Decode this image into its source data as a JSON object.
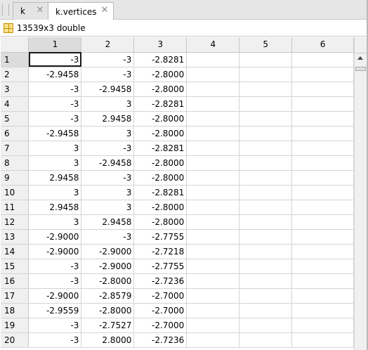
{
  "tabs": [
    {
      "label": "k",
      "active": false,
      "close_icon": "close-icon"
    },
    {
      "label": "k.vertices",
      "active": true,
      "close_icon": "close-icon"
    }
  ],
  "info": {
    "icon": "grid-icon",
    "text": "13539x3 double"
  },
  "table": {
    "columns": [
      "1",
      "2",
      "3",
      "4",
      "5",
      "6"
    ],
    "rows": [
      {
        "index": "1",
        "cells": [
          "-3",
          "-3",
          "-2.8281",
          "",
          "",
          ""
        ]
      },
      {
        "index": "2",
        "cells": [
          "-2.9458",
          "-3",
          "-2.8000",
          "",
          "",
          ""
        ]
      },
      {
        "index": "3",
        "cells": [
          "-3",
          "-2.9458",
          "-2.8000",
          "",
          "",
          ""
        ]
      },
      {
        "index": "4",
        "cells": [
          "-3",
          "3",
          "-2.8281",
          "",
          "",
          ""
        ]
      },
      {
        "index": "5",
        "cells": [
          "-3",
          "2.9458",
          "-2.8000",
          "",
          "",
          ""
        ]
      },
      {
        "index": "6",
        "cells": [
          "-2.9458",
          "3",
          "-2.8000",
          "",
          "",
          ""
        ]
      },
      {
        "index": "7",
        "cells": [
          "3",
          "-3",
          "-2.8281",
          "",
          "",
          ""
        ]
      },
      {
        "index": "8",
        "cells": [
          "3",
          "-2.9458",
          "-2.8000",
          "",
          "",
          ""
        ]
      },
      {
        "index": "9",
        "cells": [
          "2.9458",
          "-3",
          "-2.8000",
          "",
          "",
          ""
        ]
      },
      {
        "index": "10",
        "cells": [
          "3",
          "3",
          "-2.8281",
          "",
          "",
          ""
        ]
      },
      {
        "index": "11",
        "cells": [
          "2.9458",
          "3",
          "-2.8000",
          "",
          "",
          ""
        ]
      },
      {
        "index": "12",
        "cells": [
          "3",
          "2.9458",
          "-2.8000",
          "",
          "",
          ""
        ]
      },
      {
        "index": "13",
        "cells": [
          "-2.9000",
          "-3",
          "-2.7755",
          "",
          "",
          ""
        ]
      },
      {
        "index": "14",
        "cells": [
          "-2.9000",
          "-2.9000",
          "-2.7218",
          "",
          "",
          ""
        ]
      },
      {
        "index": "15",
        "cells": [
          "-3",
          "-2.9000",
          "-2.7755",
          "",
          "",
          ""
        ]
      },
      {
        "index": "16",
        "cells": [
          "-3",
          "-2.8000",
          "-2.7236",
          "",
          "",
          ""
        ]
      },
      {
        "index": "17",
        "cells": [
          "-2.9000",
          "-2.8579",
          "-2.7000",
          "",
          "",
          ""
        ]
      },
      {
        "index": "18",
        "cells": [
          "-2.9559",
          "-2.8000",
          "-2.7000",
          "",
          "",
          ""
        ]
      },
      {
        "index": "19",
        "cells": [
          "-3",
          "-2.7527",
          "-2.7000",
          "",
          "",
          ""
        ]
      },
      {
        "index": "20",
        "cells": [
          "-3",
          "2.8000",
          "-2.7236",
          "",
          "",
          ""
        ]
      }
    ]
  },
  "selection": {
    "row": "1",
    "column": "1"
  },
  "colors": {
    "tab_strip": "#e6e6e6",
    "header_bg": "#f0f0f0",
    "selected_header": "#dcdcdc",
    "grid_line": "#d4d4d4",
    "icon_fill": "#f9e08a"
  }
}
